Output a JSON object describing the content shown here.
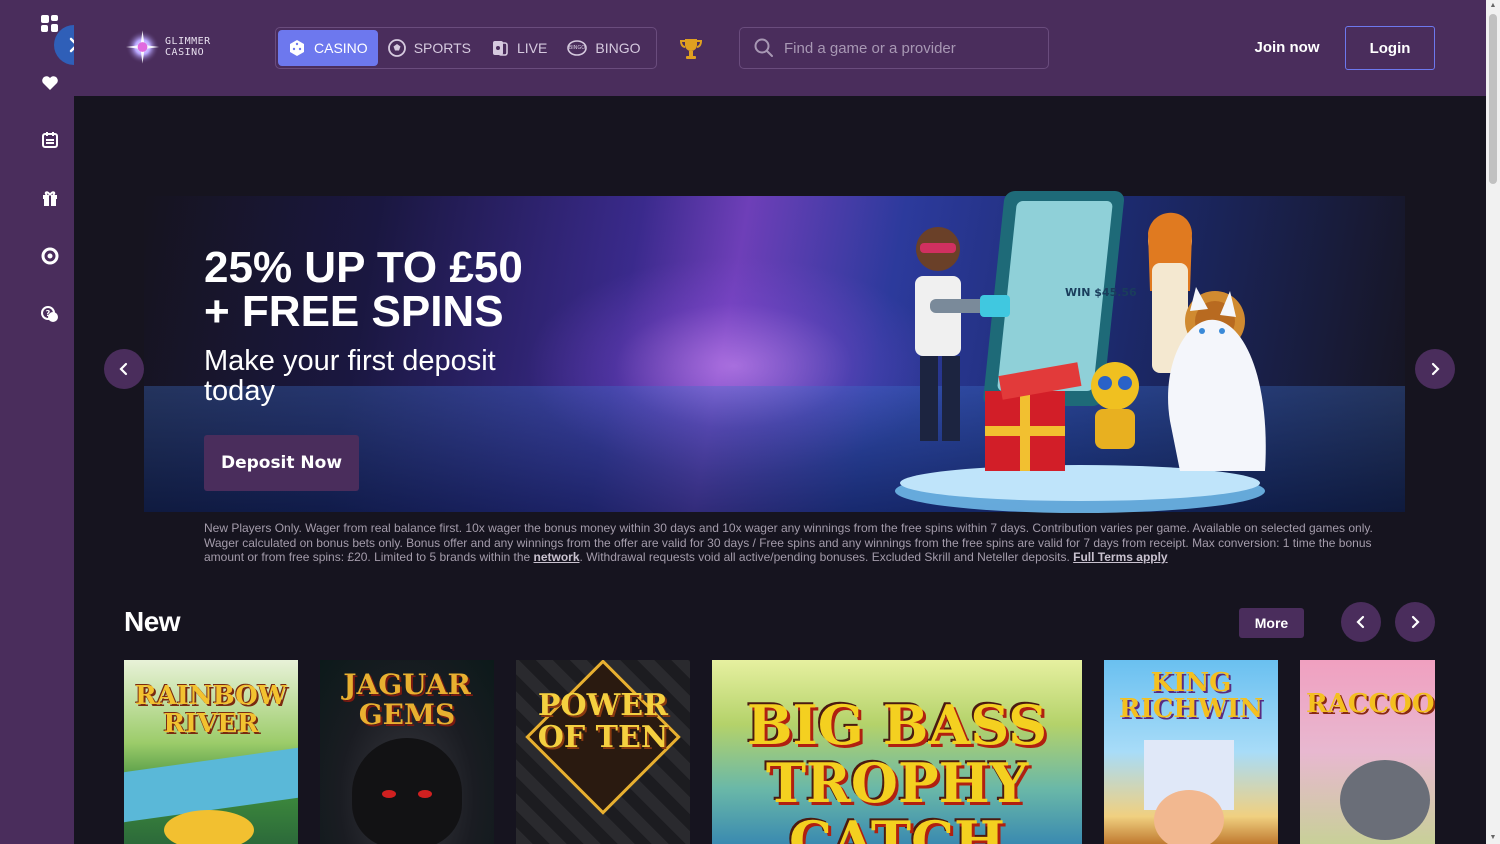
{
  "site": {
    "logo_text": "GLIMMER CASINO",
    "accent": "#6d78ee",
    "brand_purple": "#4a2d5c"
  },
  "sidebar": {
    "items": [
      {
        "icon": "grid-icon"
      },
      {
        "icon": "heart-icon"
      },
      {
        "icon": "calendar-icon"
      },
      {
        "icon": "gift-icon"
      },
      {
        "icon": "lifebuoy-icon"
      },
      {
        "icon": "chat-support-icon"
      }
    ]
  },
  "nav": {
    "tabs": [
      {
        "label": "CASINO",
        "icon": "dice-icon",
        "active": true
      },
      {
        "label": "SPORTS",
        "icon": "soccer-ball-icon",
        "active": false
      },
      {
        "label": "LIVE",
        "icon": "cards-icon",
        "active": false
      },
      {
        "label": "BINGO",
        "icon": "bingo-ball-icon",
        "active": false
      }
    ]
  },
  "search": {
    "placeholder": "Find a game or a provider"
  },
  "auth": {
    "join": "Join now",
    "login": "Login"
  },
  "promo": {
    "title_line1": "25% UP TO £50",
    "title_line2": "+ FREE SPINS",
    "subtitle": "Make your first deposit today",
    "cta": "Deposit Now",
    "slot_win": "WIN $45.56",
    "terms_text": "New Players Only. Wager from real balance first. 10x wager the bonus money within 30 days and 10x wager any winnings from the free spins within 7 days. Contribution varies per game. Available on selected games only. Wager calculated on bonus bets only. Bonus offer and any winnings from the offer are valid for 30 days / Free spins and any winnings from the free spins are valid for 7 days from receipt. Max conversion: 1 time the bonus amount or from free spins: £20. Limited to 5 brands within the",
    "terms_link1": "network",
    "terms_mid": ". Withdrawal requests void all active/pending bonuses. Excluded Skrill and Neteller deposits.",
    "terms_link2": "Full Terms apply"
  },
  "new_section": {
    "title": "New",
    "more": "More",
    "games": [
      {
        "title": "RAINBOW RIVER"
      },
      {
        "title": "JAGUAR GEMS"
      },
      {
        "title": "POWER OF TEN"
      },
      {
        "title": "BIG BASS TROPHY CATCH"
      },
      {
        "title": "KING RICHWIN"
      },
      {
        "title": "RACCOON RICHES"
      }
    ]
  }
}
